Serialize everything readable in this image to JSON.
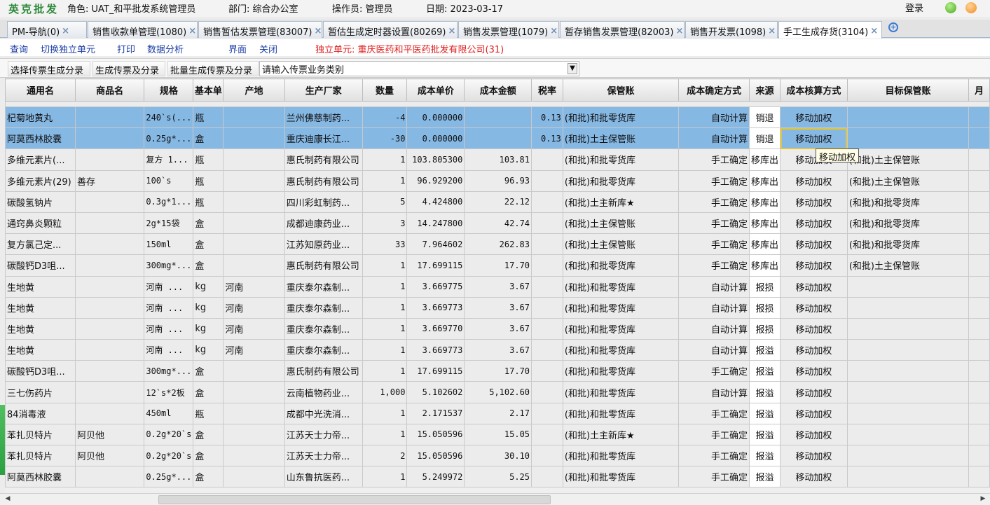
{
  "header": {
    "brand": "英克批发",
    "role": "角色: UAT_和平批发系统管理员",
    "dept": "部门: 综合办公室",
    "operator": "操作员: 管理员",
    "date": "日期: 2023-03-17",
    "login": "登录"
  },
  "tabs": [
    {
      "label": "PM-导航(0)"
    },
    {
      "label": "销售收款单管理(1080)"
    },
    {
      "label": "销售暂估发票管理(83007)"
    },
    {
      "label": "暂估生成定时器设置(80269)"
    },
    {
      "label": "销售发票管理(1079)"
    },
    {
      "label": "暂存销售发票管理(82003)"
    },
    {
      "label": "销售开发票(1098)"
    },
    {
      "label": "手工生成存货(3104)"
    }
  ],
  "menu": {
    "query": "查询",
    "switch_unit": "切换独立单元",
    "print": "打印",
    "analysis": "数据分析",
    "interface": "界面",
    "close": "关闭",
    "unit": "独立单元: 重庆医药和平医药批发有限公司(31)"
  },
  "toolbar": {
    "btn1": "选择传票生成分录",
    "btn2": "生成传票及分录",
    "btn3": "批量生成传票及分录",
    "combo_placeholder": "请输入传票业务类别"
  },
  "columns": [
    "通用名",
    "商品名",
    "规格",
    "基本单",
    "产地",
    "生产厂家",
    "数量",
    "成本单价",
    "成本金额",
    "税率",
    "保管账",
    "成本确定方式",
    "来源",
    "成本核算方式",
    "目标保管账",
    "月"
  ],
  "rows": [
    [
      "杞菊地黄丸",
      "",
      "240`s(...",
      "瓶",
      "",
      "兰州佛慈制药...",
      "-4",
      "0.000000",
      "",
      "0.13",
      "(和批)和批零货库",
      "自动计算",
      "销退",
      "移动加权",
      ""
    ],
    [
      "阿莫西林胶囊",
      "",
      "0.25g*...",
      "盒",
      "",
      "重庆迪康长江...",
      "-30",
      "0.000000",
      "",
      "0.13",
      "(和批)土主保管账",
      "自动计算",
      "销退",
      "移动加权",
      ""
    ],
    [
      "多维元素片(...",
      "",
      "复方 1...",
      "瓶",
      "",
      "惠氏制药有限公司",
      "1",
      "103.805300",
      "103.81",
      "",
      "(和批)和批零货库",
      "手工确定",
      "移库出",
      "移动加权",
      "(和批)土主保管账"
    ],
    [
      "多维元素片(29)",
      "善存",
      "100`s",
      "瓶",
      "",
      "惠氏制药有限公司",
      "1",
      "96.929200",
      "96.93",
      "",
      "(和批)和批零货库",
      "手工确定",
      "移库出",
      "移动加权",
      "(和批)土主保管账"
    ],
    [
      "碳酸氢钠片",
      "",
      "0.3g*1...",
      "瓶",
      "",
      "四川彩虹制药...",
      "5",
      "4.424800",
      "22.12",
      "",
      "(和批)土主新库★",
      "手工确定",
      "移库出",
      "移动加权",
      "(和批)和批零货库"
    ],
    [
      "通窍鼻炎颗粒",
      "",
      "2g*15袋",
      "盒",
      "",
      "成都迪康药业...",
      "3",
      "14.247800",
      "42.74",
      "",
      "(和批)土主保管账",
      "手工确定",
      "移库出",
      "移动加权",
      "(和批)和批零货库"
    ],
    [
      "复方氯己定...",
      "",
      "150ml",
      "盒",
      "",
      "江苏知原药业...",
      "33",
      "7.964602",
      "262.83",
      "",
      "(和批)土主保管账",
      "手工确定",
      "移库出",
      "移动加权",
      "(和批)和批零货库"
    ],
    [
      "碳酸钙D3咀...",
      "",
      "300mg*...",
      "盒",
      "",
      "惠氏制药有限公司",
      "1",
      "17.699115",
      "17.70",
      "",
      "(和批)和批零货库",
      "手工确定",
      "移库出",
      "移动加权",
      "(和批)土主保管账"
    ],
    [
      "生地黄",
      "",
      "河南 ...",
      "kg",
      "河南",
      "重庆泰尔森制...",
      "1",
      "3.669775",
      "3.67",
      "",
      "(和批)和批零货库",
      "自动计算",
      "报损",
      "移动加权",
      ""
    ],
    [
      "生地黄",
      "",
      "河南 ...",
      "kg",
      "河南",
      "重庆泰尔森制...",
      "1",
      "3.669773",
      "3.67",
      "",
      "(和批)和批零货库",
      "自动计算",
      "报损",
      "移动加权",
      ""
    ],
    [
      "生地黄",
      "",
      "河南 ...",
      "kg",
      "河南",
      "重庆泰尔森制...",
      "1",
      "3.669770",
      "3.67",
      "",
      "(和批)和批零货库",
      "自动计算",
      "报损",
      "移动加权",
      ""
    ],
    [
      "生地黄",
      "",
      "河南 ...",
      "kg",
      "河南",
      "重庆泰尔森制...",
      "1",
      "3.669773",
      "3.67",
      "",
      "(和批)和批零货库",
      "自动计算",
      "报溢",
      "移动加权",
      ""
    ],
    [
      "碳酸钙D3咀...",
      "",
      "300mg*...",
      "盒",
      "",
      "惠氏制药有限公司",
      "1",
      "17.699115",
      "17.70",
      "",
      "(和批)和批零货库",
      "手工确定",
      "报溢",
      "移动加权",
      ""
    ],
    [
      "三七伤药片",
      "",
      "12`s*2板",
      "盒",
      "",
      "云南植物药业...",
      "1,000",
      "5.102602",
      "5,102.60",
      "",
      "(和批)和批零货库",
      "自动计算",
      "报溢",
      "移动加权",
      ""
    ],
    [
      "84消毒液",
      "",
      "450ml",
      "瓶",
      "",
      "成都中光洗消...",
      "1",
      "2.171537",
      "2.17",
      "",
      "(和批)和批零货库",
      "手工确定",
      "报溢",
      "移动加权",
      ""
    ],
    [
      "苯扎贝特片",
      "阿贝他",
      "0.2g*20`s",
      "盒",
      "",
      "江苏天士力帝...",
      "1",
      "15.050596",
      "15.05",
      "",
      "(和批)土主新库★",
      "手工确定",
      "报溢",
      "移动加权",
      ""
    ],
    [
      "苯扎贝特片",
      "阿贝他",
      "0.2g*20`s",
      "盒",
      "",
      "江苏天士力帝...",
      "2",
      "15.050596",
      "30.10",
      "",
      "(和批)和批零货库",
      "手工确定",
      "报溢",
      "移动加权",
      ""
    ],
    [
      "阿莫西林胶囊",
      "",
      "0.25g*...",
      "盒",
      "",
      "山东鲁抗医药...",
      "1",
      "5.249972",
      "5.25",
      "",
      "(和批)和批零货库",
      "手工确定",
      "报溢",
      "移动加权",
      ""
    ]
  ],
  "tooltip": "移动加权"
}
